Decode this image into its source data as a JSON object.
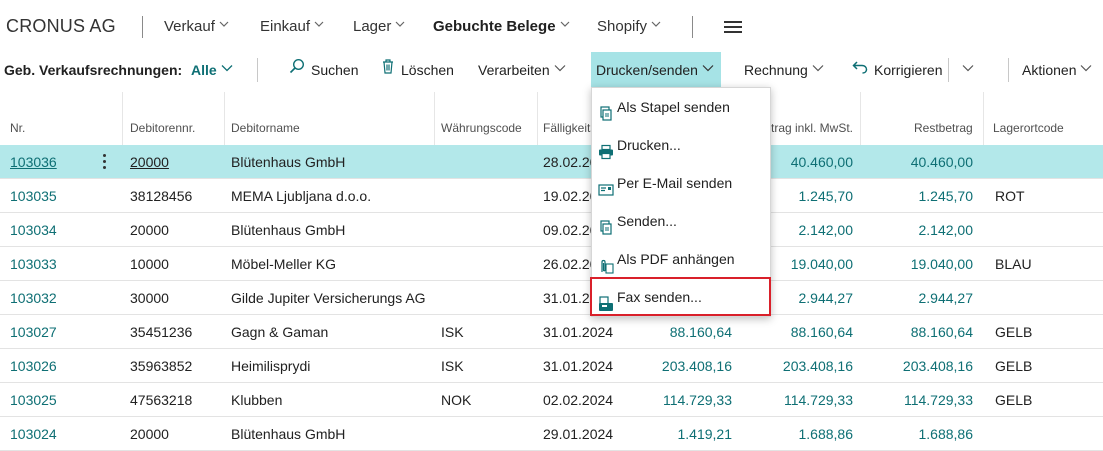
{
  "nav": {
    "company": "CRONUS AG",
    "items": [
      {
        "label": "Verkauf",
        "bold": false
      },
      {
        "label": "Einkauf",
        "bold": false
      },
      {
        "label": "Lager",
        "bold": false
      },
      {
        "label": "Gebuchte Belege",
        "bold": true
      },
      {
        "label": "Shopify",
        "bold": false
      }
    ],
    "menu_icon": "hamburger-menu-icon"
  },
  "actionbar": {
    "page_title": "Geb. Verkaufsrechnungen:",
    "filter": "Alle",
    "search": "Suchen",
    "delete": "Löschen",
    "process": "Verarbeiten",
    "print_send": "Drucken/senden",
    "invoice": "Rechnung",
    "correct": "Korrigieren",
    "actions": "Aktionen"
  },
  "dropdown": {
    "items": [
      {
        "label": "Als Stapel senden",
        "icon": "batch-send-icon"
      },
      {
        "label": "Drucken...",
        "icon": "printer-icon"
      },
      {
        "label": "Per E-Mail senden",
        "icon": "email-icon"
      },
      {
        "label": "Senden...",
        "icon": "send-icon"
      },
      {
        "label": "Als PDF anhängen",
        "icon": "attach-pdf-icon"
      },
      {
        "label": "Fax senden...",
        "icon": "fax-icon"
      }
    ],
    "highlighted": "Fax senden..."
  },
  "table": {
    "headers": {
      "nr": "Nr.",
      "debitor_nr": "Debitorennr.",
      "debitor_name": "Debitorname",
      "currency": "Währungscode",
      "due_date": "Fälligkeits",
      "amount_incl_vat": "trag inkl. MwSt.",
      "remaining": "Restbetrag",
      "location": "Lagerortcode"
    },
    "rows": [
      {
        "nr": "103036",
        "debitor_nr": "20000",
        "name": "Blütenhaus GmbH",
        "currency": "",
        "due": "28.02.20",
        "amount": "",
        "amount_incl": "40.460,00",
        "remaining": "40.460,00",
        "location": ""
      },
      {
        "nr": "103035",
        "debitor_nr": "38128456",
        "name": "MEMA Ljubljana d.o.o.",
        "currency": "",
        "due": "19.02.20",
        "amount": "",
        "amount_incl": "1.245,70",
        "remaining": "1.245,70",
        "location": "ROT"
      },
      {
        "nr": "103034",
        "debitor_nr": "20000",
        "name": "Blütenhaus GmbH",
        "currency": "",
        "due": "09.02.20",
        "amount": "",
        "amount_incl": "2.142,00",
        "remaining": "2.142,00",
        "location": ""
      },
      {
        "nr": "103033",
        "debitor_nr": "10000",
        "name": "Möbel-Meller KG",
        "currency": "",
        "due": "26.02.20",
        "amount": "",
        "amount_incl": "19.040,00",
        "remaining": "19.040,00",
        "location": "BLAU"
      },
      {
        "nr": "103032",
        "debitor_nr": "30000",
        "name": "Gilde Jupiter Versicherungs AG",
        "currency": "",
        "due": "31.01.20",
        "amount": "",
        "amount_incl": "2.944,27",
        "remaining": "2.944,27",
        "location": ""
      },
      {
        "nr": "103027",
        "debitor_nr": "35451236",
        "name": "Gagn & Gaman",
        "currency": "ISK",
        "due": "31.01.2024",
        "amount": "88.160,64",
        "amount_incl": "88.160,64",
        "remaining": "88.160,64",
        "location": "GELB"
      },
      {
        "nr": "103026",
        "debitor_nr": "35963852",
        "name": "Heimilisprydi",
        "currency": "ISK",
        "due": "31.01.2024",
        "amount": "203.408,16",
        "amount_incl": "203.408,16",
        "remaining": "203.408,16",
        "location": "GELB"
      },
      {
        "nr": "103025",
        "debitor_nr": "47563218",
        "name": "Klubben",
        "currency": "NOK",
        "due": "02.02.2024",
        "amount": "114.729,33",
        "amount_incl": "114.729,33",
        "remaining": "114.729,33",
        "location": "GELB"
      },
      {
        "nr": "103024",
        "debitor_nr": "20000",
        "name": "Blütenhaus GmbH",
        "currency": "",
        "due": "29.01.2024",
        "amount": "1.419,21",
        "amount_incl": "1.688,86",
        "remaining": "1.688,86",
        "location": ""
      }
    ]
  },
  "colors": {
    "accent": "#0e6f74",
    "selected_row": "#b3e8ea",
    "active_button": "#a6e3e6",
    "highlight_border": "#d9202a"
  }
}
